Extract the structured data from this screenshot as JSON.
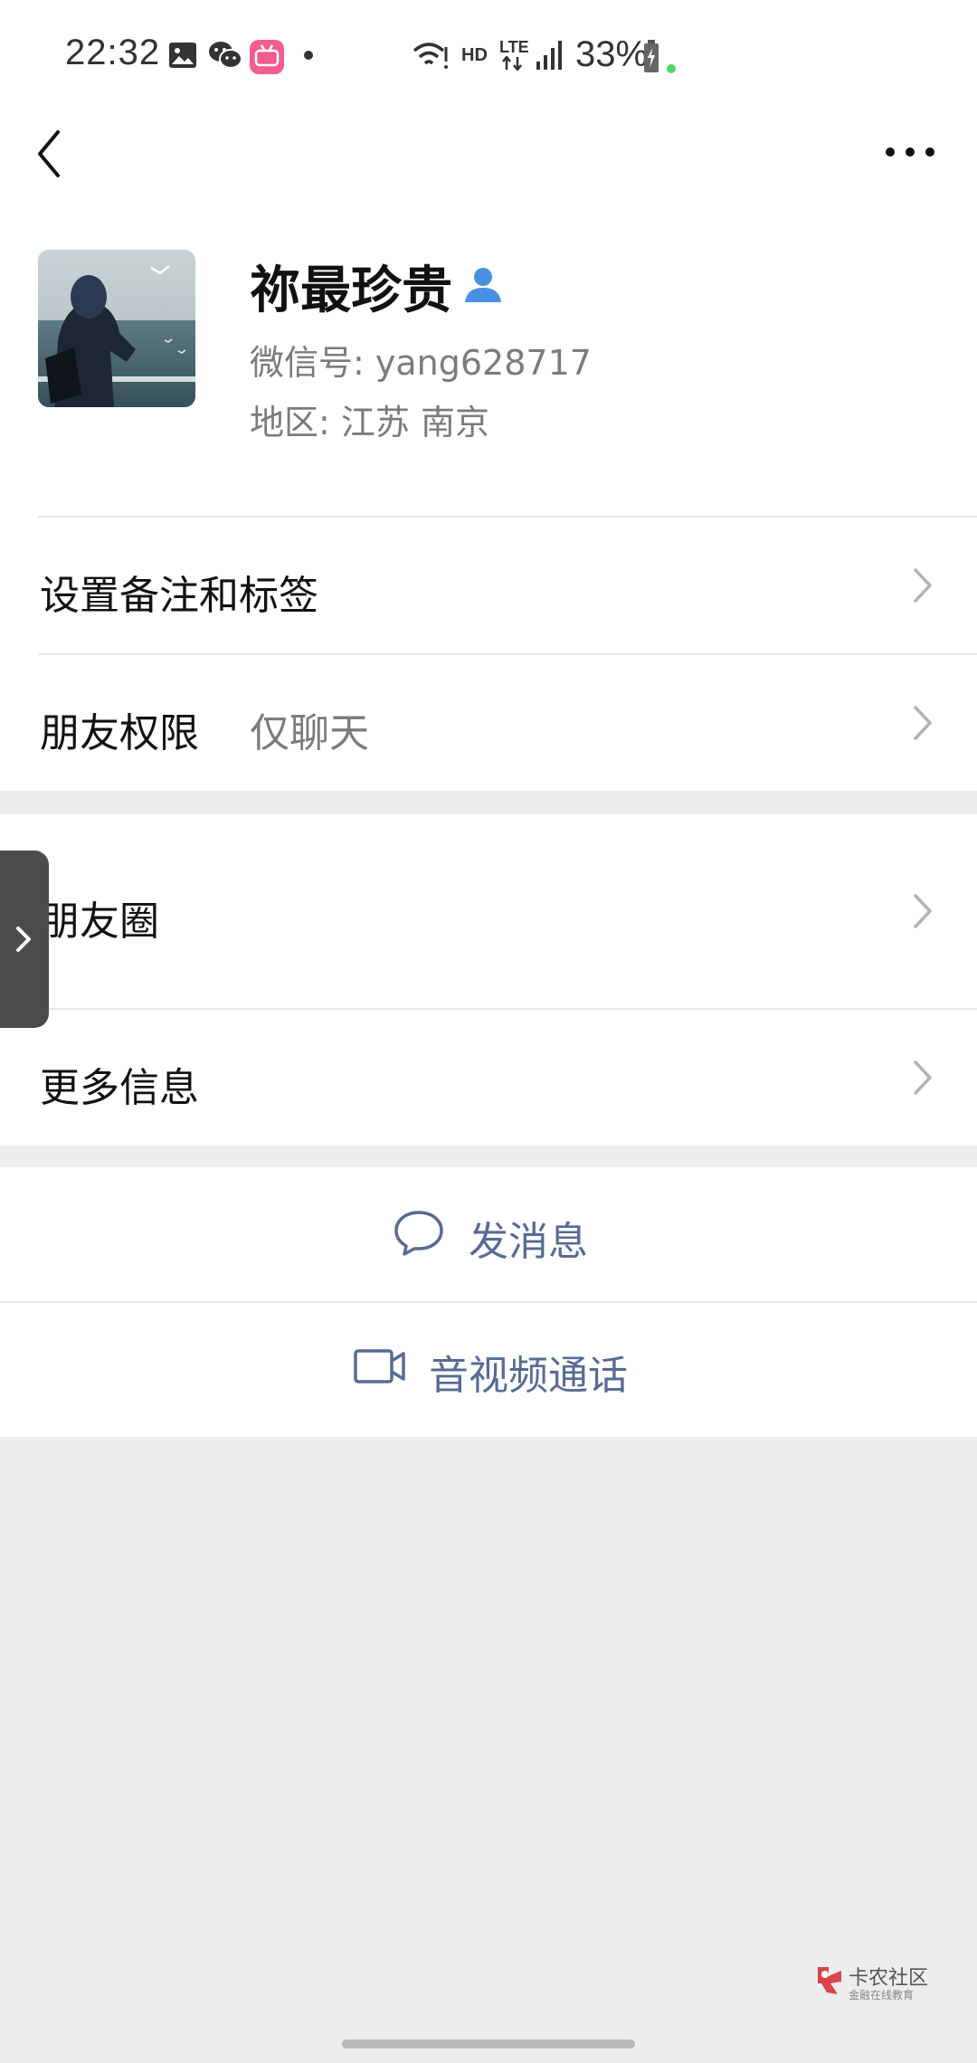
{
  "status_bar": {
    "time": "22:32",
    "network": "HD",
    "lte": "LTE",
    "battery": "33%"
  },
  "nav": {
    "back_icon": "chevron-left-icon",
    "more_icon": "more-dots-icon"
  },
  "profile": {
    "name": "祢最珍贵",
    "wechat_id": "微信号: yang628717",
    "region": "地区: 江苏  南京"
  },
  "rows": {
    "remark_label": "设置备注和标签",
    "permission_label": "朋友权限",
    "permission_value": "仅聊天",
    "moments_label": "朋友圈",
    "more_info_label": "更多信息"
  },
  "actions": {
    "message_label": "发消息",
    "call_label": "音视频通话"
  },
  "watermark": {
    "title": "卡农社区",
    "subtitle": "金融在线教育"
  },
  "colors": {
    "accent": "#576b95",
    "background": "#ededed",
    "card": "#ffffff",
    "person_icon": "#4a90e2"
  }
}
